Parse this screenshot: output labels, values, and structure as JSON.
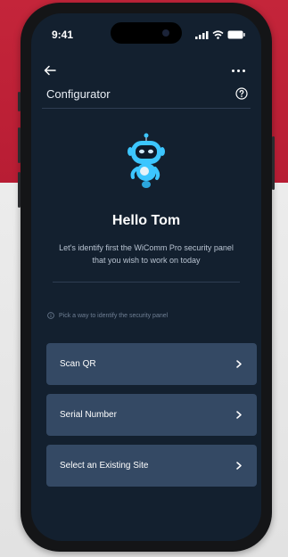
{
  "status_bar": {
    "time": "9:41"
  },
  "header": {
    "title": "Configurator",
    "back_icon": "arrow-left-icon",
    "more_icon": "more-horizontal-icon",
    "help_icon": "help-circle-icon"
  },
  "illustration": {
    "icon": "robot-mascot-icon"
  },
  "greeting": "Hello Tom",
  "intro": "Let's identify first the WiComm Pro security panel that you wish to work on today",
  "hint": "Pick a way to identify the security panel",
  "options": [
    {
      "label": "Scan QR",
      "icon": "chevron-right-icon"
    },
    {
      "label": "Serial Number",
      "icon": "chevron-right-icon"
    },
    {
      "label": "Select an Existing Site",
      "icon": "chevron-right-icon"
    }
  ],
  "colors": {
    "background_accent": "#c4253a",
    "screen": "#13202f",
    "option_card": "#344964",
    "robot_accent": "#3cc6ff"
  }
}
